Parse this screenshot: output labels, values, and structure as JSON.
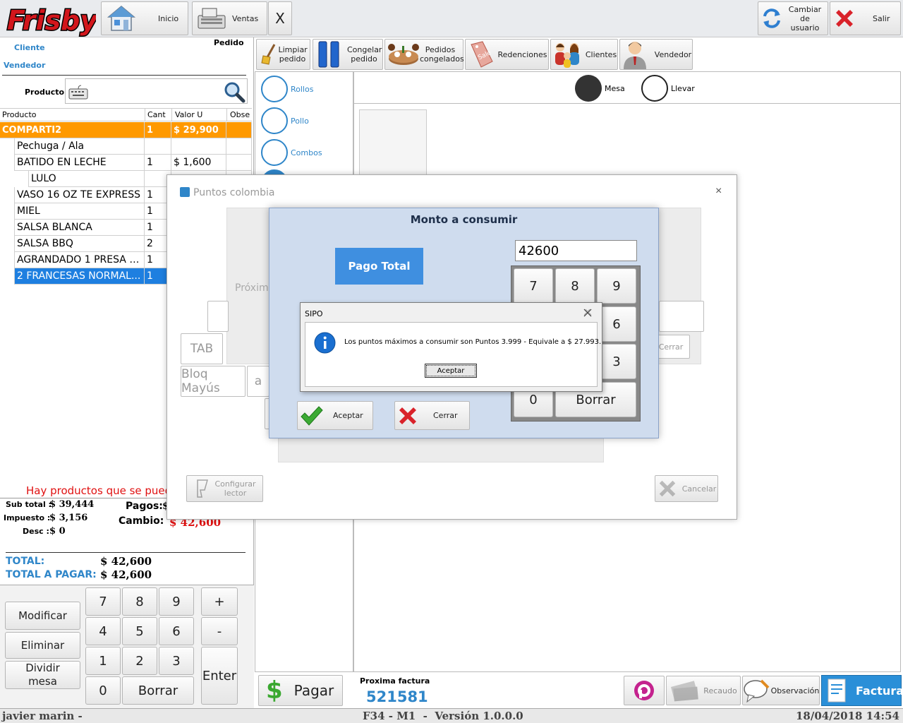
{
  "topbar": {
    "logo": "Frisby",
    "inicio": "Inicio",
    "ventas": "Ventas",
    "close": "X",
    "cambiar_usuario": "Cambiar de usuario",
    "salir": "Salir"
  },
  "left_header": {
    "cliente": "Cliente",
    "pedido": "Pedido",
    "vendedor": "Vendedor",
    "producto": "Producto"
  },
  "grid": {
    "columns": [
      "Producto",
      "Cant",
      "Valor U",
      "Obse"
    ],
    "rows": [
      {
        "producto": "COMPARTI2",
        "cant": "1",
        "valor": "$ 29,900",
        "indent": 0,
        "style": "orange"
      },
      {
        "producto": "Pechuga / Ala",
        "cant": "",
        "valor": "",
        "indent": 1,
        "style": "normal"
      },
      {
        "producto": "BATIDO EN LECHE",
        "cant": "1",
        "valor": "$ 1,600",
        "indent": 1,
        "style": "normal"
      },
      {
        "producto": "LULO",
        "cant": "",
        "valor": "",
        "indent": 2,
        "style": "normal"
      },
      {
        "producto": "VASO 16 OZ TE EXPRESS",
        "cant": "1",
        "valor": "",
        "indent": 1,
        "style": "normal"
      },
      {
        "producto": "MIEL",
        "cant": "1",
        "valor": "",
        "indent": 1,
        "style": "normal"
      },
      {
        "producto": "SALSA BLANCA",
        "cant": "1",
        "valor": "",
        "indent": 1,
        "style": "normal"
      },
      {
        "producto": "SALSA BBQ",
        "cant": "2",
        "valor": "",
        "indent": 1,
        "style": "normal"
      },
      {
        "producto": "AGRANDADO 1 PRESA S...",
        "cant": "1",
        "valor": "",
        "indent": 1,
        "style": "normal"
      },
      {
        "producto": "2 FRANCESAS NORMAL...",
        "cant": "1",
        "valor": "",
        "indent": 1,
        "style": "selected"
      }
    ]
  },
  "totals": {
    "warning": "Hay productos que se puede",
    "subtotal_label": "Sub total :",
    "subtotal": "$ 39,444",
    "impuesto_label": "Impuesto :",
    "impuesto": "$ 3,156",
    "desc_label": "Desc :",
    "desc": "$ 0",
    "pagos_label": "Pagos:",
    "pagos": "$",
    "cambio_label": "Cambio:",
    "cambio": "$ 42,600",
    "total_label": "TOTAL:",
    "total": "$ 42,600",
    "total_pagar_label": "TOTAL A PAGAR:",
    "total_pagar": "$ 42,600"
  },
  "keypad_left": {
    "modificar": "Modificar",
    "eliminar": "Eliminar",
    "dividir": "Dividir mesa",
    "keys": [
      "7",
      "8",
      "9",
      "4",
      "5",
      "6",
      "1",
      "2",
      "3",
      "0"
    ],
    "borrar": "Borrar",
    "plus": "+",
    "minus": "-",
    "enter": "Enter"
  },
  "toolbar": {
    "limpiar": "Limpiar pedido",
    "congelar": "Congelar pedido",
    "pedidos_congelados": "Pedidos congelados",
    "redenciones": "Redenciones",
    "clientes": "Clientes",
    "vendedor": "Vendedor"
  },
  "categories": [
    "Rollos",
    "Pollo",
    "Combos"
  ],
  "order_type": {
    "mesa": "Mesa",
    "llevar": "Llevar"
  },
  "bottom": {
    "pagar": "Pagar",
    "proxima_label": "Proxima factura",
    "proxima_num": "521581",
    "recaudo": "Recaudo",
    "observacion": "Observación",
    "facturar": "Facturar"
  },
  "status": {
    "user": "javier marin -",
    "terminal": "F34 - M1  -  Versión 1.0.0.0",
    "datetime": "18/04/2018 14:54"
  },
  "puntos_dialog": {
    "title": "Puntos colombia",
    "close": "×",
    "proximo": "Próxim",
    "tab": "TAB",
    "bloq": "Bloq Mayús",
    "a": "a",
    "cerrar_bg": "Cerrar",
    "configurar": "Configurar lector",
    "cancelar": "Cancelar"
  },
  "monto_dialog": {
    "title": "Monto a consumir",
    "pago_total": "Pago Total",
    "input_value": "42600",
    "keys": [
      "7",
      "8",
      "9",
      "6",
      "3",
      "0"
    ],
    "borrar": "Borrar",
    "aceptar": "Aceptar",
    "cerrar": "Cerrar"
  },
  "sipo_dialog": {
    "title": "SIPO",
    "message": "Los puntos máximos a consumir son Puntos 3.999 - Equivale a $ 27.993.",
    "aceptar": "Aceptar"
  },
  "colors": {
    "orange_row": "#ff9900",
    "selected_row": "#1e7fe0",
    "blue_label": "#2f86c9",
    "facturar_bg": "#2a8fd8"
  }
}
